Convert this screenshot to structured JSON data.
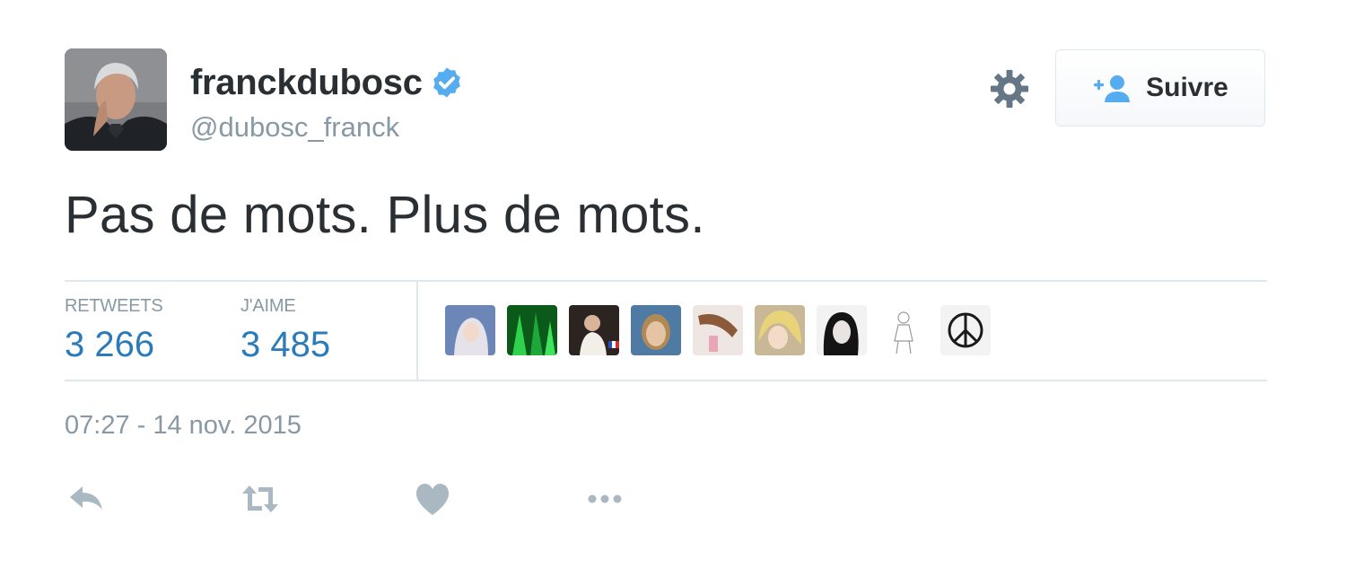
{
  "tweet": {
    "author": {
      "display_name": "franckdubosc",
      "handle": "@dubosc_franck",
      "verified": true
    },
    "text": "Pas de mots. Plus de mots.",
    "timestamp": "07:27 - 14 nov. 2015"
  },
  "header": {
    "follow_label": "Suivre",
    "settings_icon": "gear-icon",
    "follow_icon": "add-user-icon"
  },
  "stats": {
    "retweets_label": "RETWEETS",
    "retweets_value": "3 266",
    "likes_label": "J'AIME",
    "likes_value": "3 485"
  },
  "likers": [
    {
      "avatar": "liker-avatar-1"
    },
    {
      "avatar": "liker-avatar-2"
    },
    {
      "avatar": "liker-avatar-3"
    },
    {
      "avatar": "liker-avatar-4"
    },
    {
      "avatar": "liker-avatar-5"
    },
    {
      "avatar": "liker-avatar-6"
    },
    {
      "avatar": "liker-avatar-7"
    },
    {
      "avatar": "liker-avatar-8"
    },
    {
      "avatar": "peace-symbol-avatar"
    }
  ],
  "actions": [
    "reply-icon",
    "retweet-icon",
    "like-heart-icon",
    "more-options-icon"
  ],
  "colors": {
    "text": "#292f33",
    "muted": "#8899a6",
    "link": "#2b7bb9",
    "verified": "#55acee",
    "divider": "#e1e8ed",
    "action_icon": "#aab8c2"
  }
}
